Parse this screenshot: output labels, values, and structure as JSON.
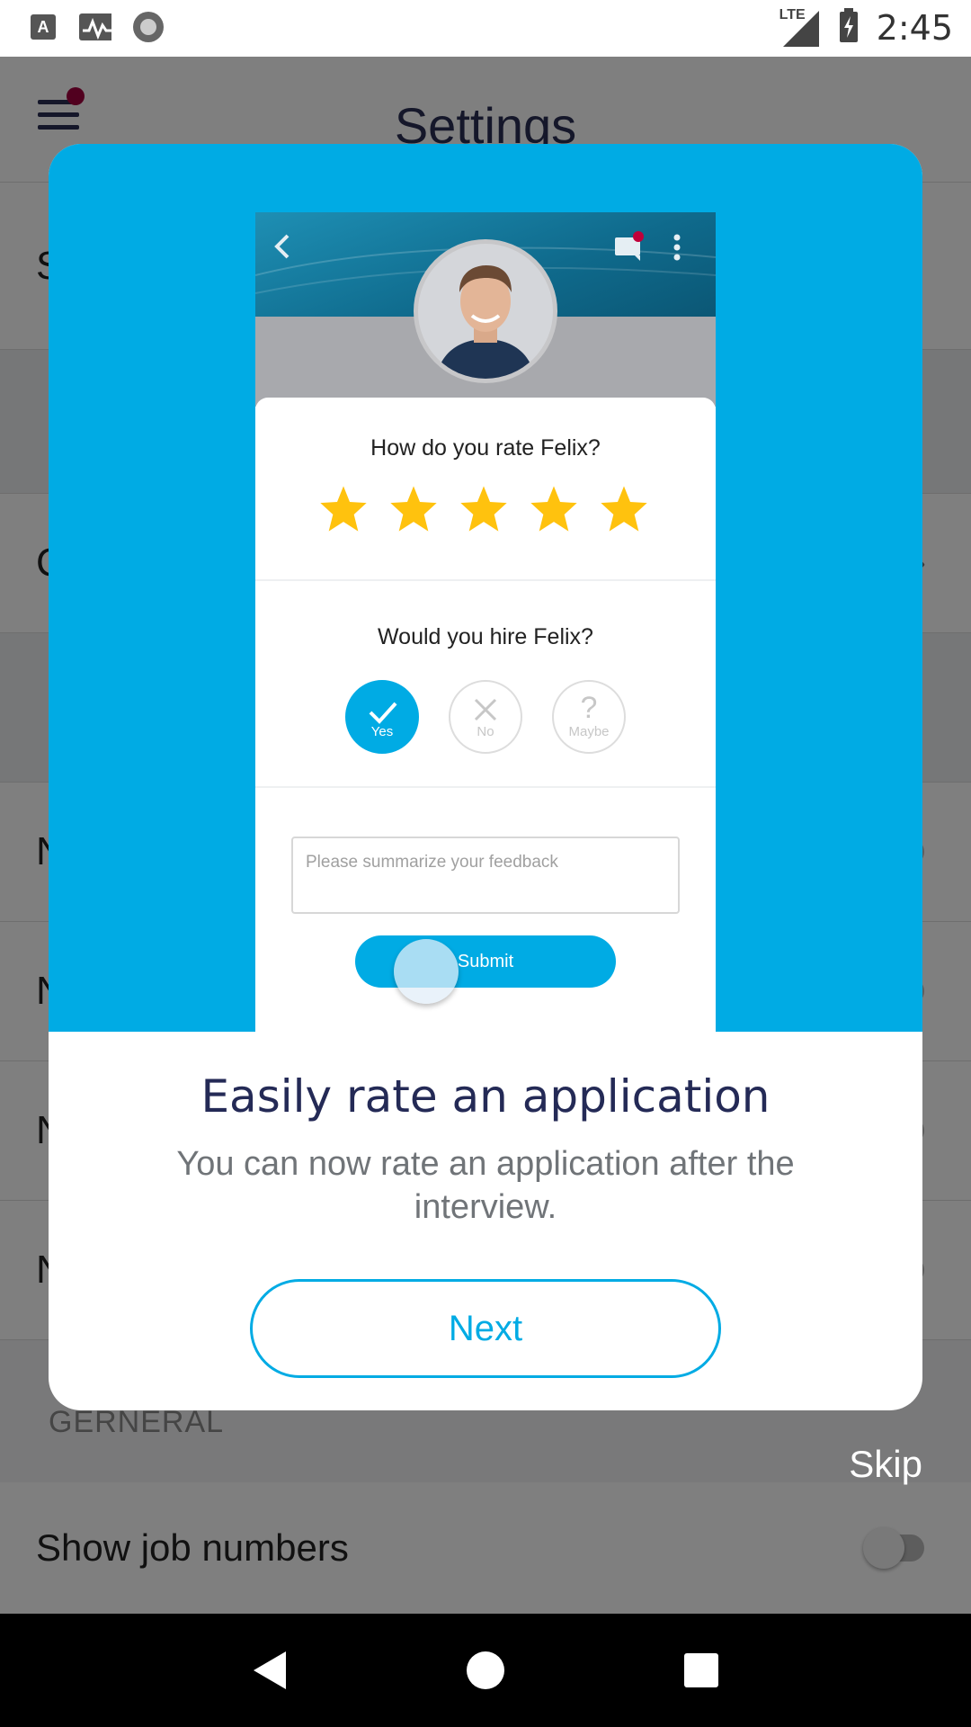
{
  "status_bar": {
    "time": "2:45",
    "network": "LTE",
    "icons": [
      "a-notification-icon",
      "activity-icon",
      "record-icon",
      "signal-icon",
      "battery-charging-icon"
    ]
  },
  "settings_screen": {
    "title": "Settings",
    "rows": [
      {
        "label": "S"
      },
      {
        "label": ""
      },
      {
        "label": "C"
      },
      {
        "label": ""
      },
      {
        "label": "N"
      },
      {
        "label": "N"
      },
      {
        "label": "N"
      },
      {
        "label": "N"
      }
    ],
    "section_label": "GERNERAL",
    "show_job_numbers": "Show job numbers"
  },
  "dialog": {
    "title": "Easily rate an application",
    "body": "You can now rate an application after the interview.",
    "next_label": "Next",
    "skip_label": "Skip",
    "accent_color": "#00abe4",
    "preview": {
      "rate_question": "How do you rate Felix?",
      "rating": 5,
      "max_rating": 5,
      "hire_question": "Would you hire Felix?",
      "options": [
        {
          "label": "Yes",
          "selected": true
        },
        {
          "label": "No",
          "selected": false
        },
        {
          "label": "Maybe",
          "selected": false
        }
      ],
      "feedback_placeholder": "Please summarize your feedback",
      "submit_label": "Submit"
    }
  }
}
